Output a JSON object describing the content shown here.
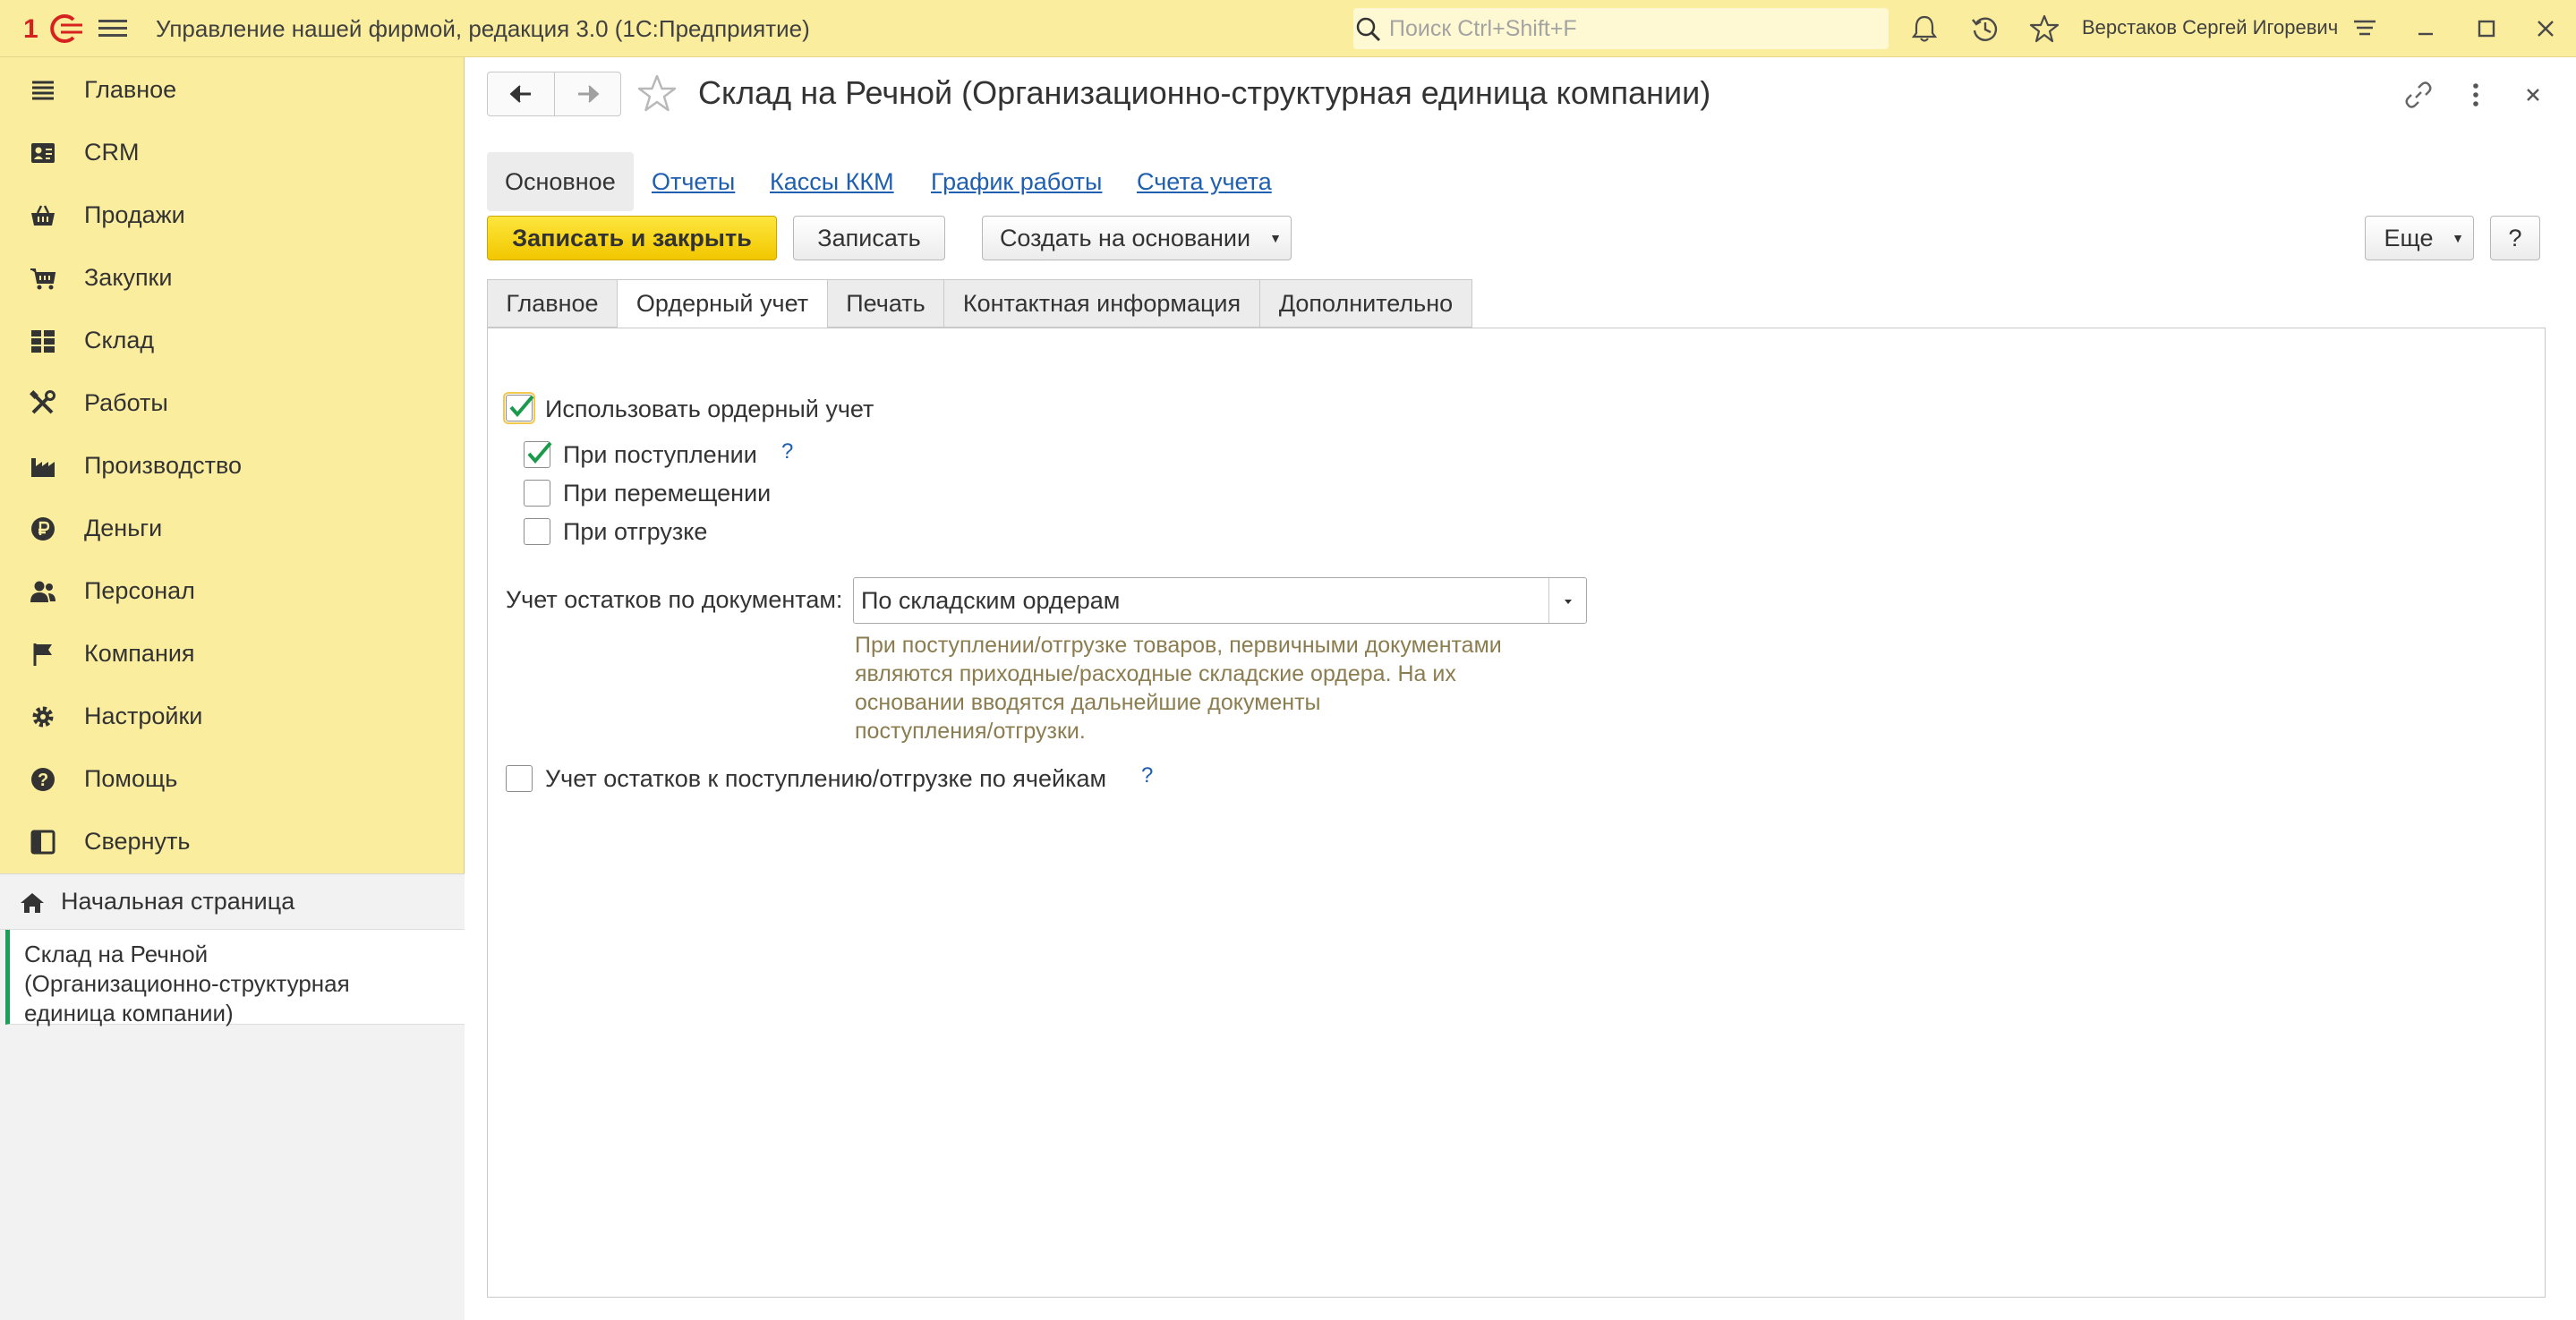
{
  "app": {
    "title": "Управление нашей фирмой, редакция 3.0  (1С:Предприятие)",
    "search_placeholder": "Поиск Ctrl+Shift+F",
    "user": "Верстаков Сергей Игоревич",
    "logo_text": "1С"
  },
  "sidebar": {
    "items": [
      {
        "label": "Главное",
        "icon": "hamburger-list-icon"
      },
      {
        "label": "CRM",
        "icon": "contacts-card-icon"
      },
      {
        "label": "Продажи",
        "icon": "basket-icon"
      },
      {
        "label": "Закупки",
        "icon": "cart-icon"
      },
      {
        "label": "Склад",
        "icon": "warehouse-grid-icon"
      },
      {
        "label": "Работы",
        "icon": "tools-icon"
      },
      {
        "label": "Производство",
        "icon": "factory-icon"
      },
      {
        "label": "Деньги",
        "icon": "ruble-coin-icon"
      },
      {
        "label": "Персонал",
        "icon": "people-icon"
      },
      {
        "label": "Компания",
        "icon": "flag-icon"
      },
      {
        "label": "Настройки",
        "icon": "gear-icon"
      },
      {
        "label": "Помощь",
        "icon": "help-circle-icon"
      },
      {
        "label": "Свернуть",
        "icon": "collapse-panel-icon"
      }
    ],
    "home": "Начальная страница",
    "open_window": {
      "line1": "Склад на Речной",
      "line2": "(Организационно-структурная",
      "line3": "единица компании)"
    }
  },
  "form": {
    "title": "Склад на Речной (Организационно-структурная единица компании)",
    "panel": {
      "active": "Основное",
      "links": [
        "Отчеты",
        "Кассы ККМ",
        "График работы",
        "Счета учета"
      ]
    },
    "commands": {
      "save_close": "Записать и закрыть",
      "save": "Записать",
      "create_based": "Создать на основании",
      "more": "Еще",
      "help": "?"
    },
    "tabs": [
      "Главное",
      "Ордерный учет",
      "Печать",
      "Контактная информация",
      "Дополнительно"
    ],
    "active_tab": "Ордерный учет",
    "order": {
      "use_order": {
        "label": "Использовать ордерный учет",
        "checked": true
      },
      "on_receipt": {
        "label": "При поступлении",
        "checked": true
      },
      "on_transfer": {
        "label": "При перемещении",
        "checked": false
      },
      "on_shipment": {
        "label": "При отгрузке",
        "checked": false
      },
      "help": "?",
      "balances_label": "Учет остатков по документам:",
      "balances_value": "По складским ордерам",
      "hint": [
        "При поступлении/отгрузке товаров, первичными документами",
        "являются приходные/расходные складские ордера. На их",
        "основании вводятся дальнейшие документы",
        "поступления/отгрузки."
      ],
      "cells": {
        "label": "Учет остатков к поступлению/отгрузке по ячейкам",
        "checked": false
      }
    }
  },
  "colors": {
    "title_bar": "#fbed9e",
    "primary_button": "#f2c700",
    "link": "#1f5fb0",
    "check": "#1a9a4a",
    "hint_text": "#8b7d4f",
    "logo": "#d6221f"
  }
}
